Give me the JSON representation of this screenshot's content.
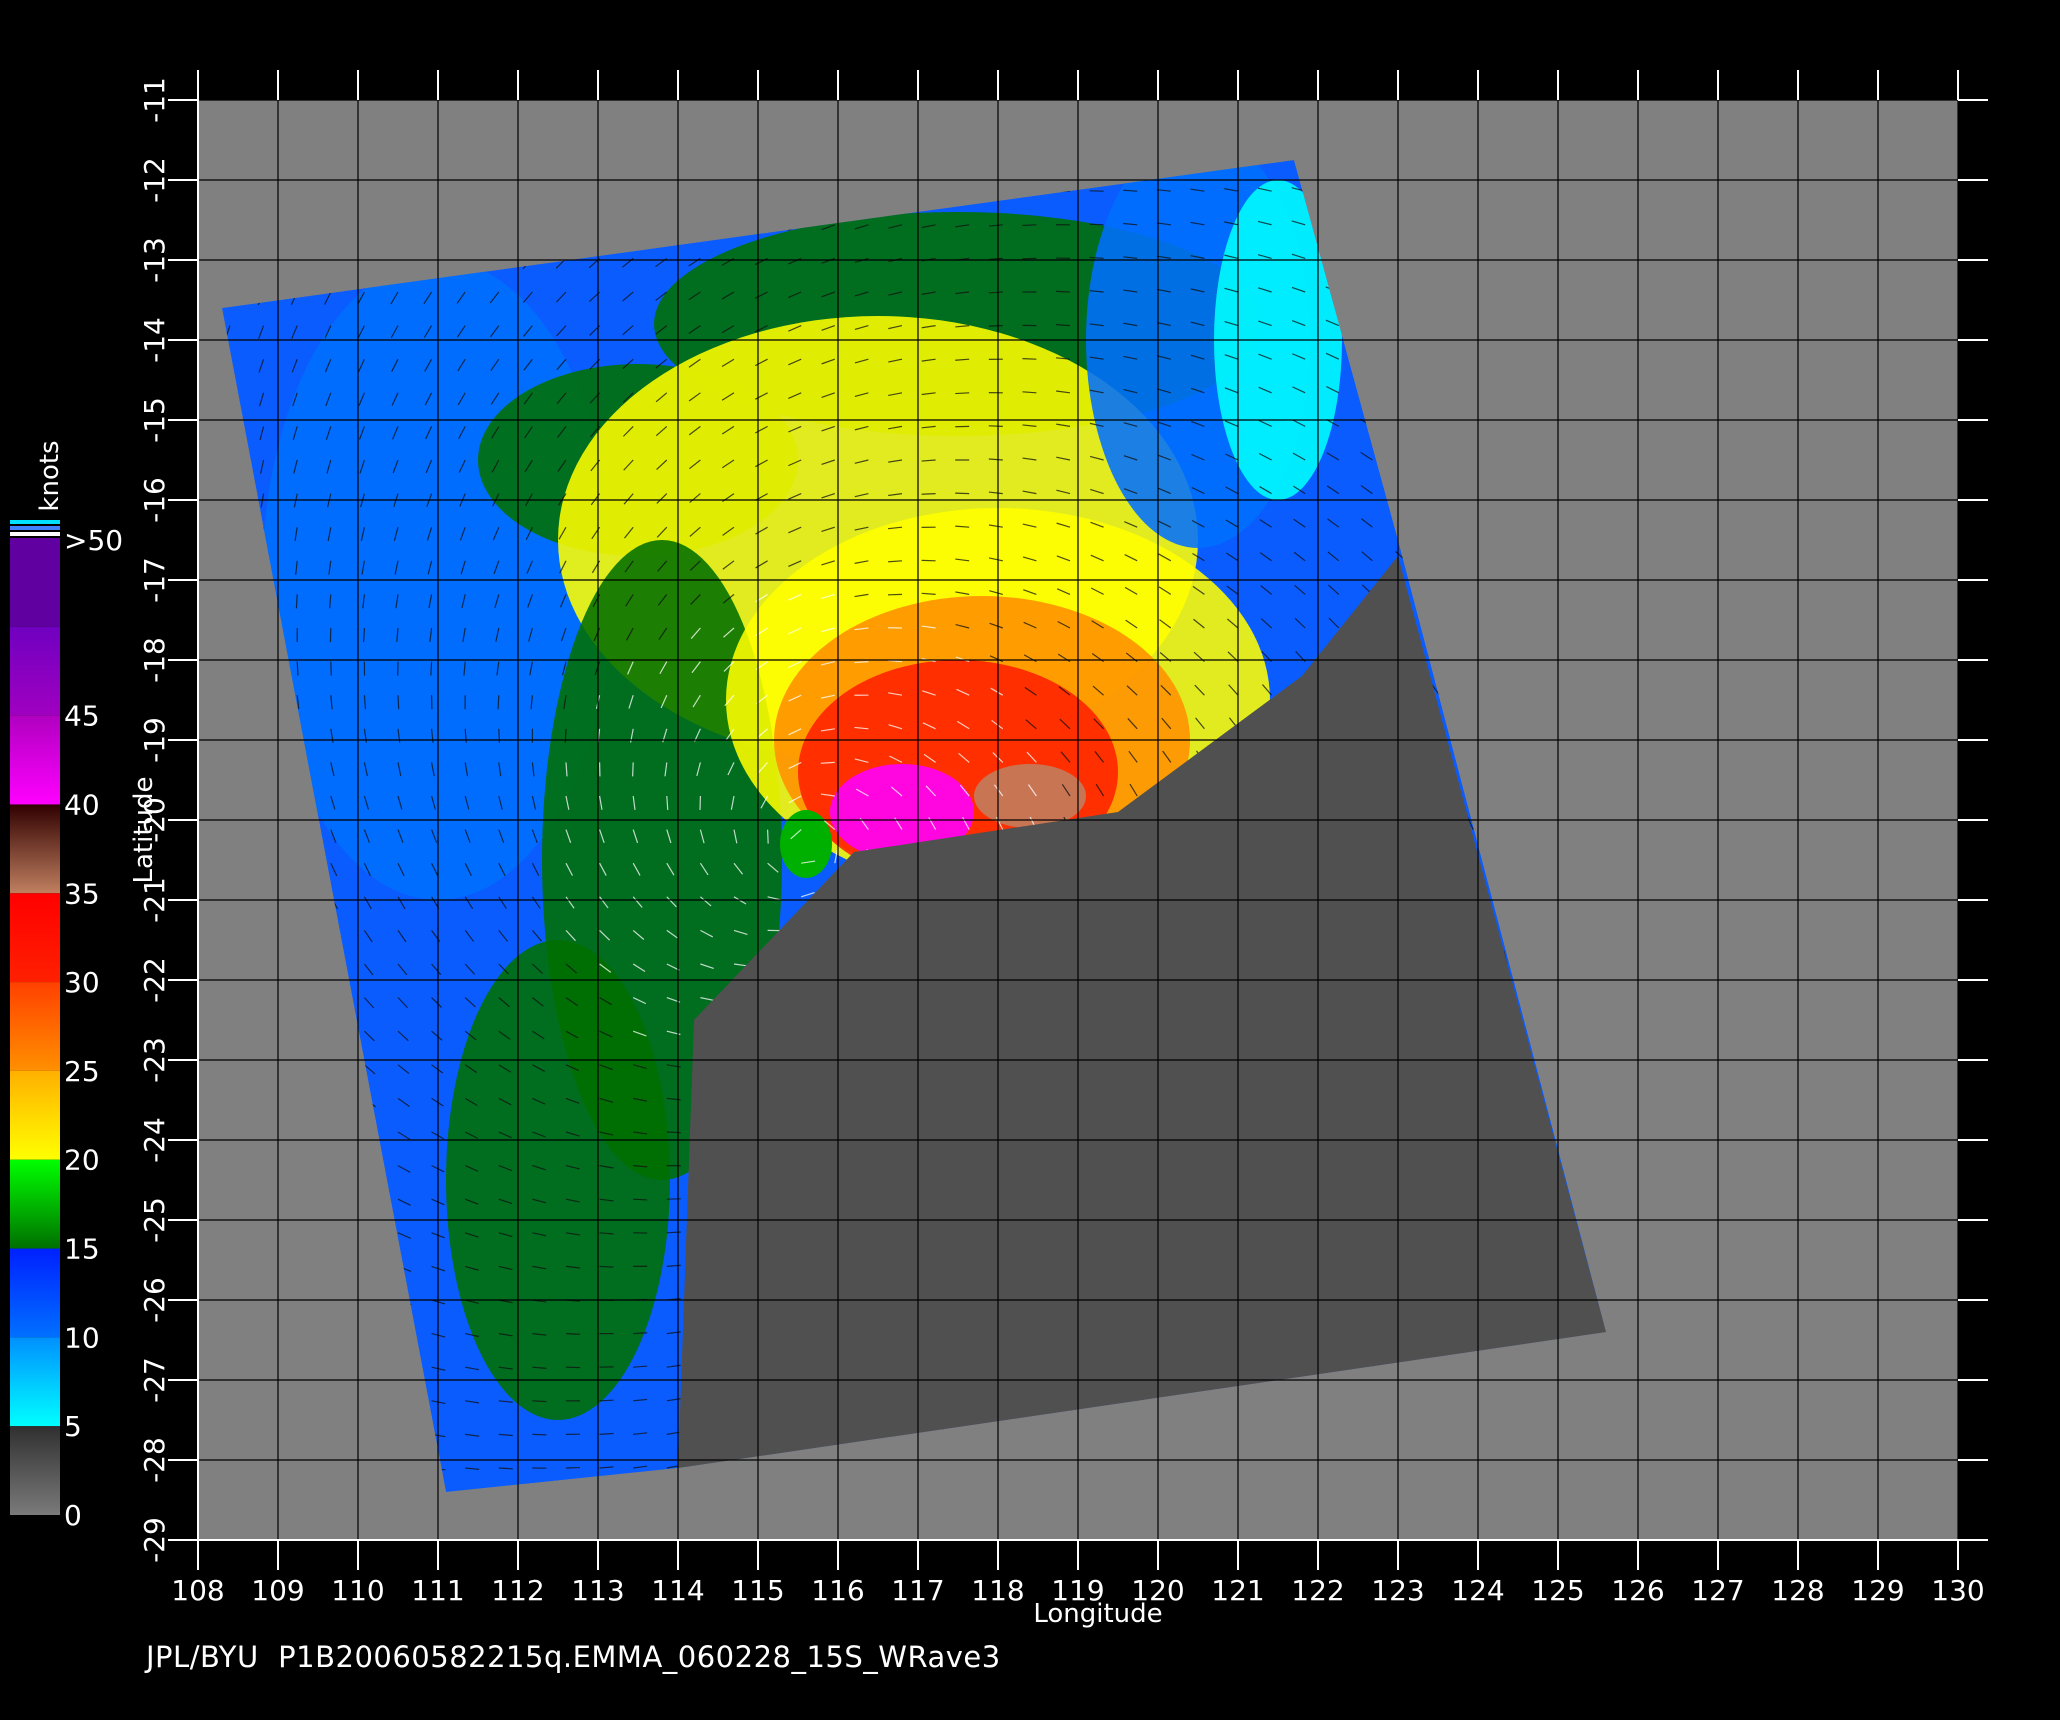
{
  "chart_data": {
    "type": "map",
    "xlabel": "Longitude",
    "ylabel": "Latitude",
    "xlim": [
      108,
      130
    ],
    "ylim": [
      -29,
      -11
    ],
    "x_ticks": [
      "108",
      "109",
      "110",
      "111",
      "112",
      "113",
      "114",
      "115",
      "116",
      "117",
      "118",
      "119",
      "120",
      "121",
      "122",
      "123",
      "124",
      "125",
      "126",
      "127",
      "128",
      "129",
      "130"
    ],
    "y_ticks": [
      "-11",
      "-12",
      "-13",
      "-14",
      "-15",
      "-16",
      "-17",
      "-18",
      "-19",
      "-20",
      "-21",
      "-22",
      "-23",
      "-24",
      "-25",
      "-26",
      "-27",
      "-28",
      "-29"
    ],
    "swath_corners_lonlat": [
      [
        108.3,
        -13.6
      ],
      [
        121.7,
        -11.75
      ],
      [
        123.0,
        -16.5
      ],
      [
        125.6,
        -26.4
      ],
      [
        114.0,
        -28.1
      ],
      [
        111.1,
        -28.4
      ]
    ],
    "land_overlay_corners_lonlat": [
      [
        123.0,
        -16.7
      ],
      [
        125.6,
        -26.4
      ],
      [
        114.0,
        -28.1
      ],
      [
        114.2,
        -22.5
      ],
      [
        116.2,
        -20.4
      ],
      [
        119.5,
        -19.9
      ],
      [
        121.8,
        -18.2
      ]
    ],
    "grid": true,
    "background_color": "#808080",
    "land_color": "#505050",
    "wind_speed_bins_knots": [
      {
        "label": "0",
        "from": 0,
        "to": 5,
        "colors": [
          "#7a7a7a",
          "#303030"
        ]
      },
      {
        "label": "5",
        "from": 5,
        "to": 10,
        "colors": [
          "#00ffff",
          "#0090ff"
        ]
      },
      {
        "label": "10",
        "from": 10,
        "to": 15,
        "colors": [
          "#0070ff",
          "#0020ff"
        ]
      },
      {
        "label": "15",
        "from": 15,
        "to": 20,
        "colors": [
          "#007000",
          "#00ff00"
        ]
      },
      {
        "label": "20",
        "from": 20,
        "to": 25,
        "colors": [
          "#ffff00",
          "#ffb000"
        ]
      },
      {
        "label": "25",
        "from": 25,
        "to": 30,
        "colors": [
          "#ff9000",
          "#ff4000"
        ]
      },
      {
        "label": "30",
        "from": 30,
        "to": 35,
        "colors": [
          "#ff2000",
          "#ff0000"
        ]
      },
      {
        "label": "35",
        "from": 35,
        "to": 40,
        "colors": [
          "#c08060",
          "#300000"
        ]
      },
      {
        "label": "40",
        "from": 40,
        "to": 45,
        "colors": [
          "#ff00ff",
          "#b000c0"
        ]
      },
      {
        "label": "45",
        "from": 45,
        "to": 50,
        "colors": [
          "#a000c0",
          "#7000c0"
        ]
      },
      {
        "label": ">50",
        "from": 50,
        "to": null,
        "colors": [
          "#6000a0"
        ]
      }
    ],
    "colorbar_title": "knots",
    "storm_center_lonlat": [
      115.6,
      -20.3
    ]
  },
  "footer": {
    "producer": "JPL/BYU",
    "product_id": "P1B20060582215q.EMMA_060228_15S_WRave3"
  },
  "colors": {
    "background": "#000000",
    "text": "#ffffff"
  }
}
